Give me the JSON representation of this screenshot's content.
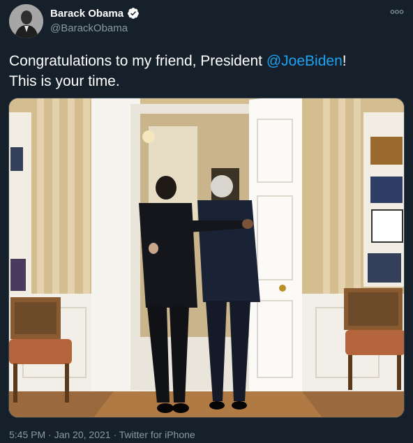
{
  "author": {
    "display_name": "Barack Obama",
    "handle": "@BarackObama",
    "verified": true,
    "avatar_icon": "profile-photo"
  },
  "tweet": {
    "text_before": "Congratulations to my friend, President ",
    "mention": "@JoeBiden",
    "text_after_line1": "!",
    "text_line2": "This is your time."
  },
  "media": {
    "description_icon": "photo"
  },
  "footer": {
    "time": "5:45 PM",
    "separator1": " · ",
    "date": "Jan 20, 2021",
    "separator2": " · ",
    "source": "Twitter for iPhone"
  },
  "colors": {
    "background": "#15202b",
    "text": "#ffffff",
    "secondary_text": "#8899a6",
    "link": "#1da1f2"
  }
}
